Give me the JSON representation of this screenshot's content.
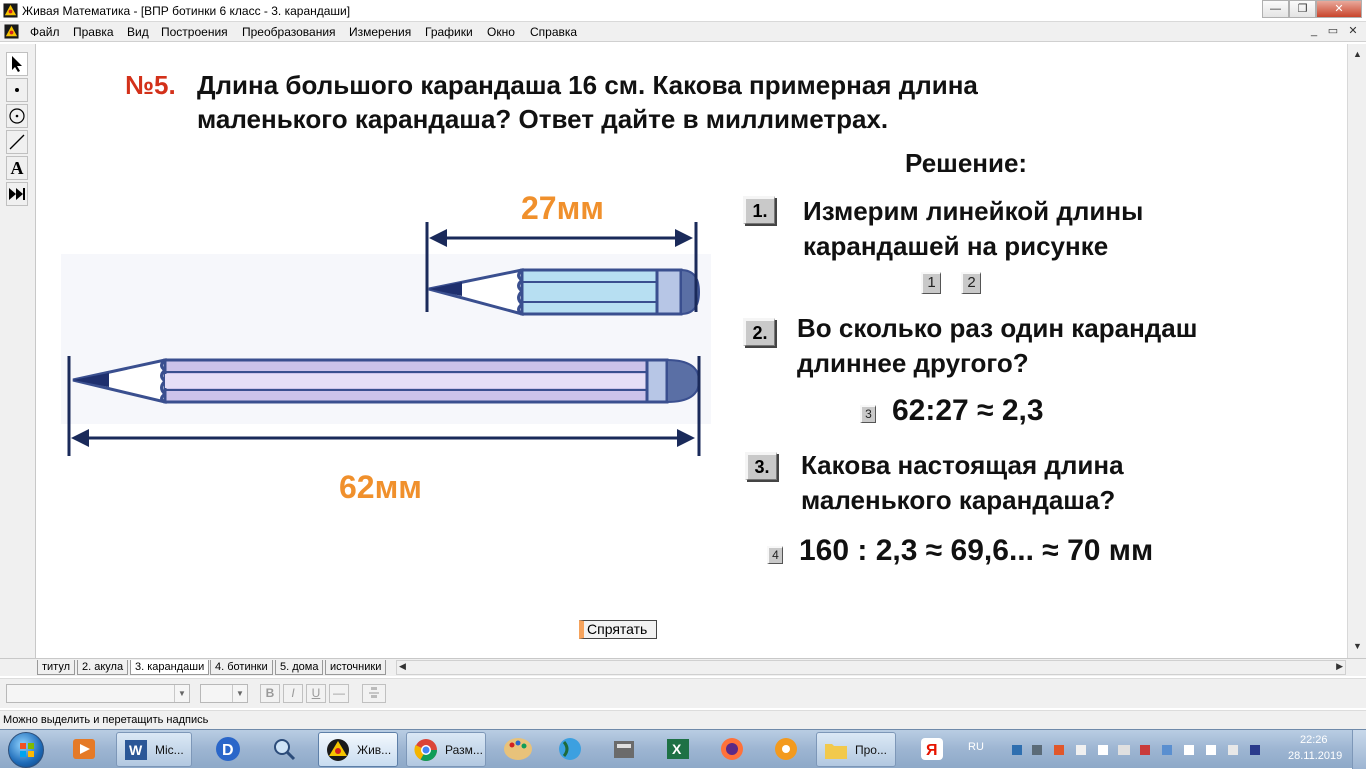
{
  "window": {
    "title": "Живая Математика - [ВПР ботинки 6 класс - 3. карандаши]",
    "controls": {
      "minimize": "—",
      "restore": "❐",
      "close": "✕"
    }
  },
  "menubar": {
    "items": [
      "Файл",
      "Правка",
      "Вид",
      "Построения",
      "Преобразования",
      "Измерения",
      "Графики",
      "Окно",
      "Справка"
    ],
    "mdi_controls": {
      "minimize": "_",
      "restore": "▭",
      "close": "✕"
    }
  },
  "toolbox": {
    "tools": [
      "arrow-tool",
      "point-tool",
      "compass-tool",
      "straightedge-tool",
      "text-tool",
      "custom-tool"
    ],
    "text_tool_glyph": "A"
  },
  "problem": {
    "number": "№5.",
    "text": "Длина большого карандаша 16 см. Какова примерная длина\nмаленького карандаша? Ответ дайте в миллиметрах."
  },
  "figure": {
    "small_length_label": "27мм",
    "big_length_label": "62мм"
  },
  "solution": {
    "title": "Решение:",
    "steps": [
      {
        "badge": "1.",
        "text": "Измерим линейкой длины\nкарандашей на рисунке"
      },
      {
        "badge": "2.",
        "text": "Во сколько раз один карандаш\nдлиннее другого?"
      },
      {
        "badge": "3.",
        "text": "Какова настоящая длина\nмаленького карандаша?"
      }
    ],
    "buttons": [
      "1",
      "2",
      "3",
      "4"
    ],
    "ratio_formula": "62:27 ≈ 2,3",
    "answer_formula": "160 : 2,3 ≈ 69,6... ≈ 70 мм"
  },
  "hide_button": "Спрятать",
  "tabs": [
    "титул",
    "2. акула",
    "3. карандаши",
    "4. ботинки",
    "5. дома",
    "источники"
  ],
  "active_tab": "3. карандаши",
  "formatbar": {
    "bold": "B",
    "italic": "I",
    "underline": "U",
    "dash": "—"
  },
  "status": "Можно выделить и перетащить надпись",
  "taskbar": {
    "items": [
      {
        "label": "Mic...",
        "icon": "word-icon"
      },
      {
        "label": "Жив...",
        "icon": "geometers-sketchpad-icon"
      },
      {
        "label": "Разм...",
        "icon": "chrome-icon"
      },
      {
        "label": "Про...",
        "icon": "folder-icon"
      }
    ],
    "language": "RU",
    "time": "22:26",
    "date": "28.11.2019"
  },
  "colors": {
    "problem_number": "#d3311a",
    "length_labels": "#f0902c",
    "arrows": "#1a2a5a"
  }
}
